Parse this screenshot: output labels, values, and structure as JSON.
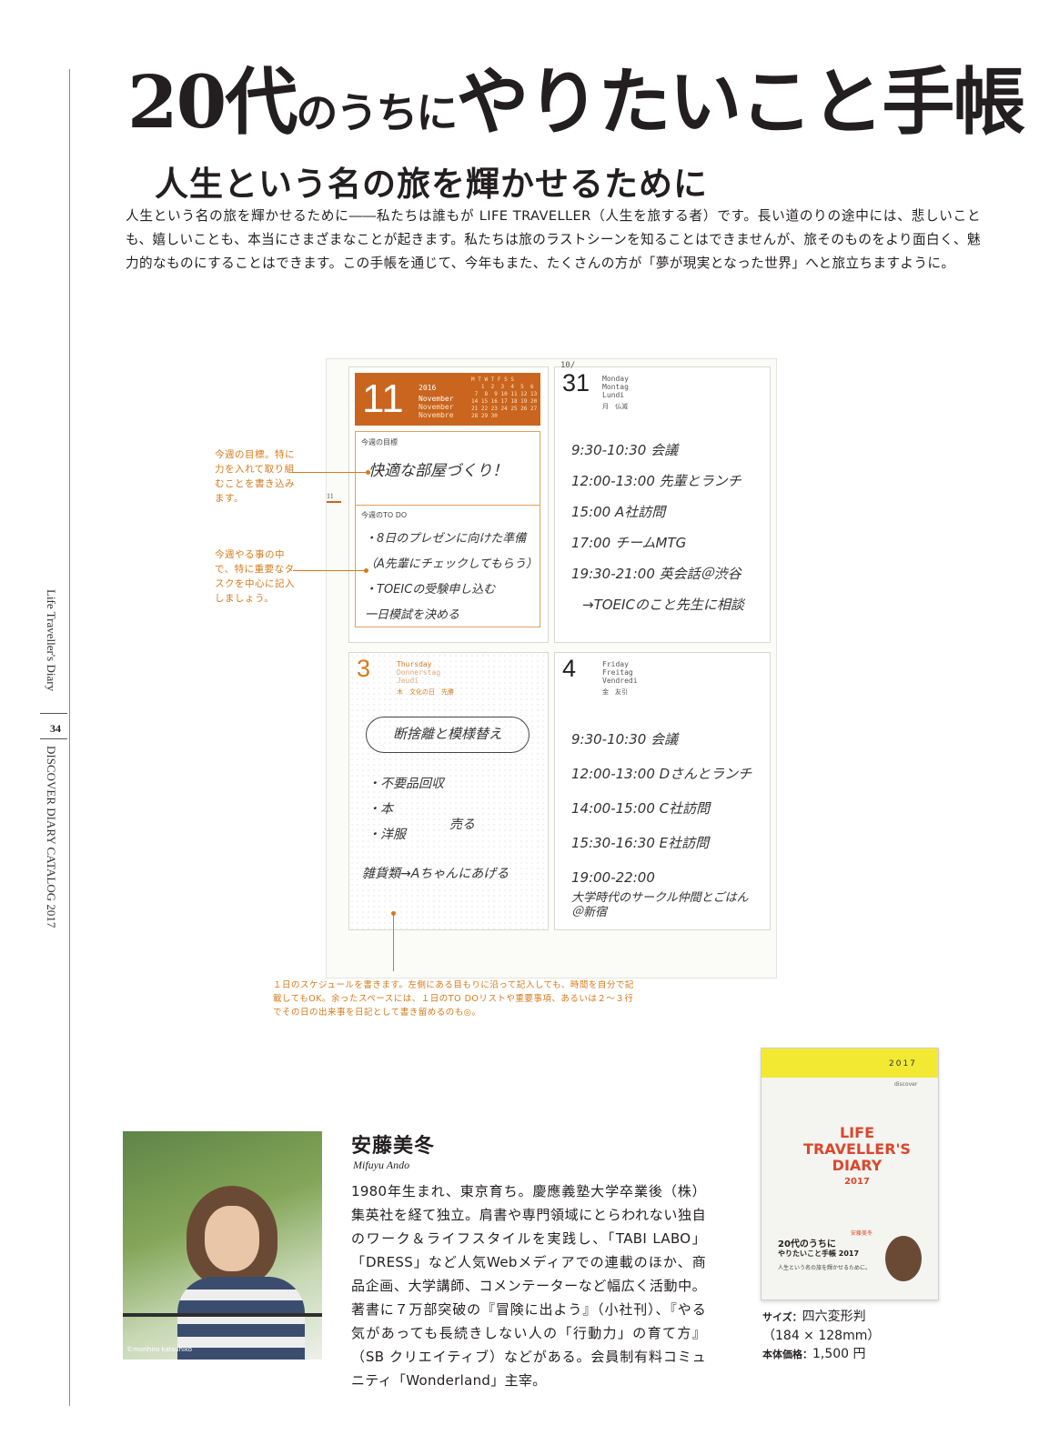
{
  "running_header": {
    "series": "Life Traveller's Diary",
    "page": "34",
    "catalog": "DISCOVER DIARY CATALOG 2017"
  },
  "title": {
    "part1": "20代",
    "part2": "のうちに",
    "part3": "やりたいこと手帳"
  },
  "subtitle": "人生という名の旅を輝かせるために",
  "intro": "人生という名の旅を輝かせるために――私たちは誰もが LIFE TRAVELLER（人生を旅する者）です。長い道のりの途中には、悲しいことも、嬉しいことも、本当にさまざまなことが起きます。私たちは旅のラストシーンを知ることはできませんが、旅そのものをより面白く、魅力的なものにすることはできます。この手帳を通じて、今年もまた、たくさんの方が「夢が現実となった世界」へと旅立ちますように。",
  "diary": {
    "week": {
      "num": "11",
      "year": "2016",
      "month_lines": [
        "November",
        "November",
        "Novembre"
      ],
      "cal_head": "M T W T F S S",
      "cal_rows": [
        "   1  2  3  4  5  6",
        " 7  8  9 10 11 12 13",
        "14 15 16 17 18 19 20",
        "21 22 23 24 25 26 27",
        "28 29 30"
      ],
      "goal_label": "今週の目標",
      "goal_text": "快適な部屋づくり！",
      "todo_label": "今週のTO DO",
      "todos": [
        "・8日のプレゼンに向けた準備",
        "（A先輩にチェックしてもらう）",
        "・TOEICの受験申し込む",
        "一日模試を決める"
      ],
      "side_tab": "11"
    },
    "oct31": {
      "prefix": "10/",
      "num": "31",
      "names": [
        "Monday",
        "Montag",
        "Lundi"
      ],
      "jp": "月　仏滅",
      "entries": [
        "9:30-10:30 会議",
        "12:00-13:00 先輩とランチ",
        "15:00 A社訪問",
        "17:00 チームMTG",
        "19:30-21:00 英会話＠渋谷",
        "→TOEICのこと先生に相談"
      ]
    },
    "nov3": {
      "num": "3",
      "names": [
        "Thursday",
        "Donnerstag",
        "Jeudi"
      ],
      "jp": "木　文化の日　先勝",
      "cloud": "断捨離と模様替え",
      "entries": [
        "・不要品回収",
        "・本",
        "・洋服",
        "売る",
        "雑貨類→Aちゃんにあげる"
      ]
    },
    "nov4": {
      "num": "4",
      "names": [
        "Friday",
        "Freitag",
        "Vendredi"
      ],
      "jp": "金　友引",
      "entries": [
        "9:30-10:30 会議",
        "12:00-13:00 Dさんとランチ",
        "14:00-15:00 C社訪問",
        "15:30-16:30 E社訪問",
        "19:00-22:00",
        "大学時代のサークル仲間とごはん＠新宿"
      ]
    }
  },
  "annotations": {
    "goal": "今週の目標。特に力を入れて取り組むことを書き込みます。",
    "todo": "今週やる事の中で、特に重要なタスクを中心に記入しましょう。",
    "daily": "１日のスケジュールを書きます。左側にある目もりに沿って記入しても、時間を自分で記載してもOK。余ったスペースには、１日のTO DOリストや重要事項、あるいは２～３行でその日の出来事を日記として書き留めるのも◎。"
  },
  "bio": {
    "name": "安藤美冬",
    "roman": "Mifuyu Ando",
    "text": "1980年生まれ、東京育ち。慶應義塾大学卒業後（株）集英社を経て独立。肩書や専門領域にとらわれない独自のワーク＆ライフスタイルを実践し、「TABI LABO」「DRESS」など人気Webメディアでの連載のほか、商品企画、大学講師、コメンテーターなど幅広く活動中。著書に７万部突破の『冒険に出よう』（小社刊）、『やる気があっても長続きしない人の「行動力」の育て方』（SB クリエイティブ）などがある。会員制有料コミュニティ「Wonderland」主宰。",
    "photo_credit": "©morihiro katsuhiko"
  },
  "book": {
    "year": "2017",
    "publisher": "discover",
    "title_lines": [
      "LIFE",
      "TRAVELLER'S",
      "DIARY",
      "2017"
    ],
    "jp_title": "20代のうちに",
    "jp_title2": "やりたいこと手帳 2017",
    "author": "安藤美冬",
    "tagline": "人生という名の旅を輝かせるために。"
  },
  "specs": {
    "size_label": "サイズ：",
    "size_value": "四六変形判",
    "dims": "（184 × 128mm）",
    "price_label": "本体価格：",
    "price_value": "1,500 円"
  },
  "colors": {
    "accent": "#c9651e",
    "annotation": "#d57a1a",
    "book_band": "#f2ea32",
    "book_title": "#d9482b"
  }
}
